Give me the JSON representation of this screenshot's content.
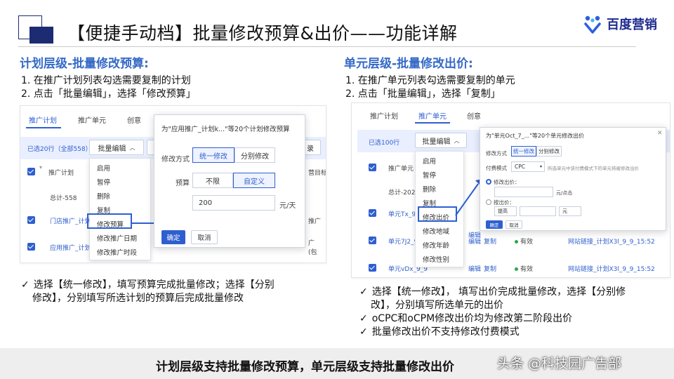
{
  "header": {
    "title": "【便捷手动档】批量修改预算&出价——功能详解",
    "brand": "百度营销",
    "accent": "#1d2b73",
    "brand_color": "#1f2c8f"
  },
  "left": {
    "title": "计划层级-批量修改预算:",
    "steps": [
      "1.  在推广计划列表勾选需要复制的计划",
      "2.  点击「批量编辑」，选择「修改预算」"
    ],
    "shot": {
      "tabs": [
        "推广计划",
        "推广单元",
        "创意"
      ],
      "selected_text": "已选20行（全部558）",
      "batch_btn": "批量编辑",
      "right_btn": "录",
      "col_plan": "推广计划",
      "col_goal": "营目标",
      "total_row": "总计-558",
      "rows": [
        "门店推广_计划",
        "应用推广_计划"
      ],
      "row_right_1": "推广",
      "row_right_2a": "广",
      "row_right_2b": "(包",
      "menu": [
        "启用",
        "暂停",
        "删除",
        "复制",
        "修改预算",
        "修改推广日期",
        "修改推广时段"
      ],
      "dialog": {
        "title": "为\"应用推广_计划k...\"等20个计划修改预算",
        "mode_label": "修改方式",
        "mode_options": [
          "统一修改",
          "分别修改"
        ],
        "budget_label": "预算",
        "budget_options": [
          "不限",
          "自定义"
        ],
        "budget_value": "200",
        "unit": "元/天",
        "ok": "确定",
        "cancel": "取消"
      }
    },
    "notes": [
      "选择【统一修改】，填写预算完成批量修改；选择【分别",
      "修改】，分别填写所选计划的预算后完成批量修改"
    ]
  },
  "right": {
    "title": "单元层级-批量修改出价:",
    "steps": [
      "1.  在推广单元列表勾选需要复制的单元",
      "2.  点击「批量编辑」，选择「复制」"
    ],
    "shot": {
      "tabs": [
        "推广计划",
        "推广单元",
        "创意"
      ],
      "selected_text": "已选100行",
      "batch_btn": "批量编辑",
      "col_unit": "推广单元",
      "total_row": "总计-202",
      "rows": [
        {
          "name": "单元Tx_9_9_1",
          "edit": "编辑",
          "copy": "",
          "status": "",
          "link": ""
        },
        {
          "name": "单元7J2_9_9",
          "edit": "编辑",
          "copy": "复制",
          "status": "有效",
          "link": "网站链接_计划X3l_9_9_15:52"
        },
        {
          "name": "单元vDx_9_9",
          "edit": "编辑",
          "copy": "复制",
          "status": "有效",
          "link": "网站链接_计划X3l_9_9_15:52"
        }
      ],
      "menu": [
        "启用",
        "暂停",
        "删除",
        "复制",
        "修改出价",
        "修改地域",
        "修改年龄",
        "修改性别"
      ],
      "dialog": {
        "title": "为\"单元Oct_7_...\"等20个单元修改出价",
        "mode_label": "修改方式",
        "mode_options": [
          "统一修改",
          "分别修改"
        ],
        "pay_label": "付费模式",
        "pay_value": "CPC",
        "pay_hint": "所选单元中该付费模式下的单元将被修改出价",
        "bid_radio": "修改出价：",
        "bid_unit": "元/点击",
        "ratio_radio": "按出价：",
        "ratio_select": "提高",
        "ratio_unit": "元",
        "ok": "确定",
        "cancel": "取消"
      }
    },
    "notes": [
      "选择【统一修改】， 填写出价完成批量修改，选择【分别修",
      "改】，分别填写所选单元的出价",
      "oCPC和oCPM修改出价均为修改第二阶段出价",
      "批量修改出价不支持修改付费模式"
    ]
  },
  "footer": {
    "text": "计划层级支持批量修改预算，单元层级支持批量修改出价",
    "watermark": "头条 @科技园广告部"
  }
}
